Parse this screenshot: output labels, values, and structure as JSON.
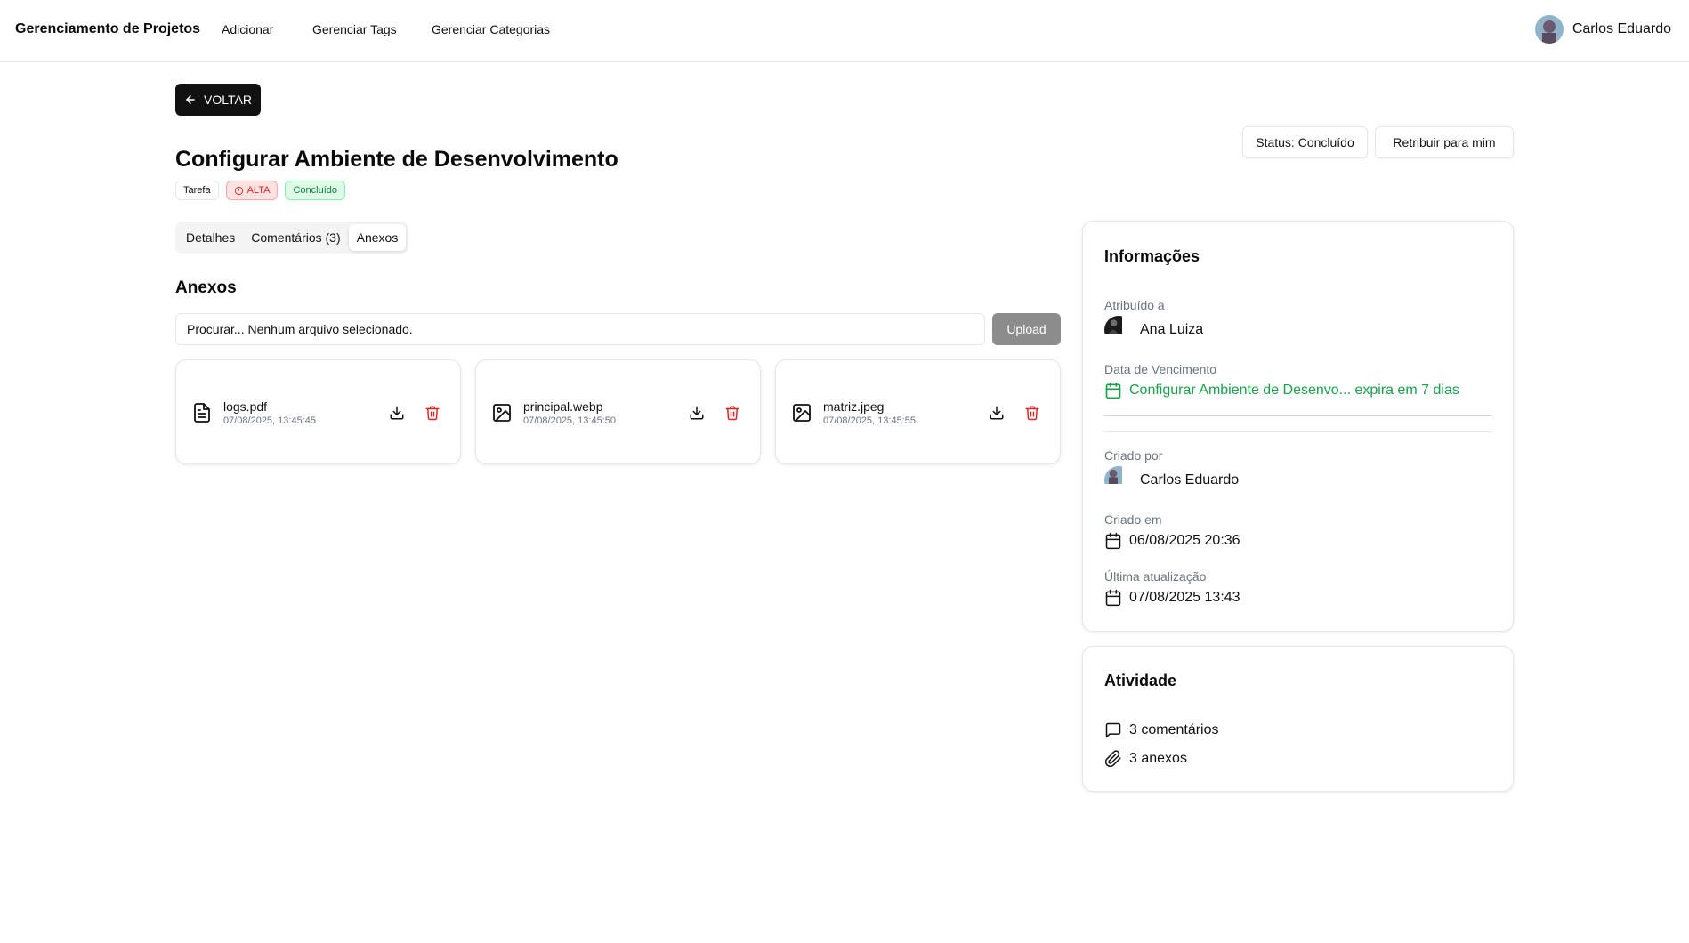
{
  "nav": {
    "brand": "Gerenciamento de Projetos",
    "links": [
      "Adicionar",
      "Gerenciar Tags",
      "Gerenciar Categorias"
    ],
    "user_name": "Carlos Eduardo"
  },
  "back_label": "VOLTAR",
  "task": {
    "title": "Configurar Ambiente de Desenvolvimento",
    "type_badge": "Tarefa",
    "priority_badge": "ALTA",
    "status_badge": "Concluído",
    "status_button": "Status: Concluído",
    "reassign_button": "Retribuir para mim"
  },
  "tabs": [
    {
      "label": "Detalhes",
      "active": false
    },
    {
      "label": "Comentários (3)",
      "active": false
    },
    {
      "label": "Anexos",
      "active": true
    }
  ],
  "attachments": {
    "title": "Anexos",
    "file_input_text": "Procurar... Nenhum arquivo selecionado.",
    "upload_label": "Upload",
    "files": [
      {
        "name": "logs.pdf",
        "date": "07/08/2025, 13:45:45",
        "icon": "file-text-icon"
      },
      {
        "name": "principal.webp",
        "date": "07/08/2025, 13:45:50",
        "icon": "image-icon"
      },
      {
        "name": "matriz.jpeg",
        "date": "07/08/2025, 13:45:55",
        "icon": "image-icon"
      }
    ]
  },
  "info": {
    "title": "Informações",
    "assigned_label": "Atribuído a",
    "assigned_name": "Ana Luiza",
    "due_label": "Data de Vencimento",
    "due_text": "Configurar Ambiente de Desenvo... expira em 7 dias",
    "created_by_label": "Criado por",
    "created_by_name": "Carlos Eduardo",
    "created_at_label": "Criado em",
    "created_at": "06/08/2025 20:36",
    "updated_label": "Última atualização",
    "updated_at": "07/08/2025 13:43"
  },
  "activity": {
    "title": "Atividade",
    "comments": "3 comentários",
    "attachments": "3 anexos"
  },
  "colors": {
    "accent_dark": "#111111",
    "priority_red": "#dc2626",
    "status_green": "#16a34a",
    "upload_gray": "#8c8c8c"
  }
}
